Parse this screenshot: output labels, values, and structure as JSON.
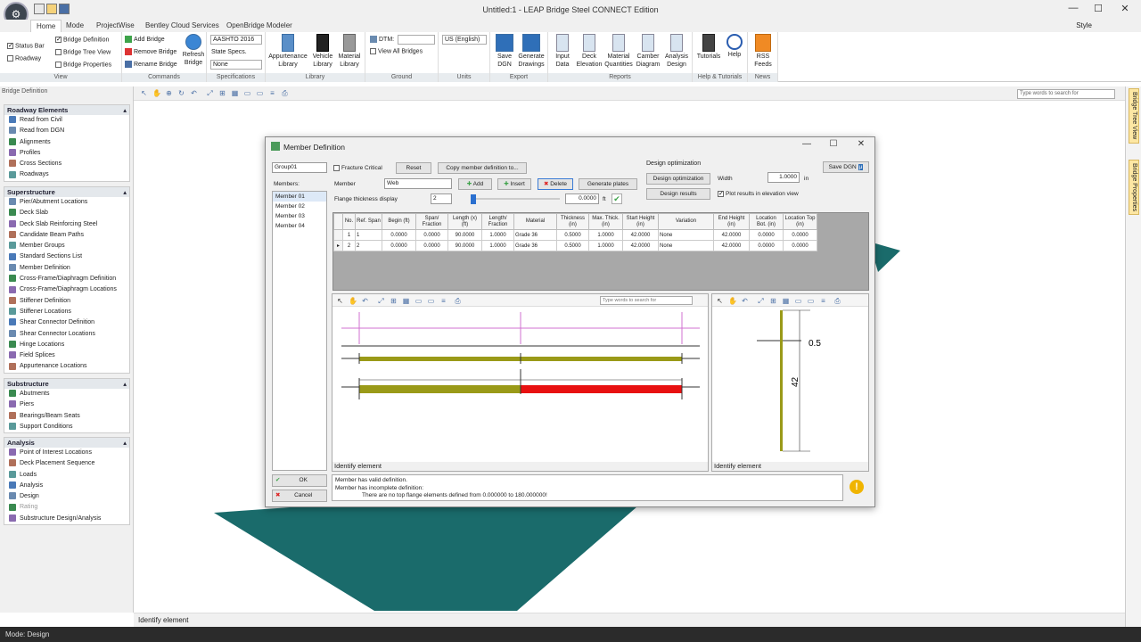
{
  "window": {
    "title": "Untitled:1 - LEAP Bridge Steel CONNECT Edition",
    "min": "—",
    "max": "☐",
    "close": "✕"
  },
  "tabs": [
    "Home",
    "Mode",
    "ProjectWise",
    "Bentley Cloud Services",
    "OpenBridge Modeler"
  ],
  "style_label": "Style",
  "ribbon": {
    "view": {
      "label": "View",
      "status_bar": "Status Bar",
      "roadway": "Roadway",
      "bridge_definition": "Bridge Definition",
      "bridge_tree_view": "Bridge Tree View",
      "bridge_properties": "Bridge Properties"
    },
    "commands": {
      "label": "Commands",
      "add_bridge": "Add Bridge",
      "remove_bridge": "Remove Bridge",
      "rename_bridge": "Rename Bridge",
      "refresh_bridge": "Refresh Bridge"
    },
    "specifications": {
      "label": "Specifications",
      "code": "AASHTO 2016",
      "state_specs": "State Specs.",
      "state_value": "None"
    },
    "library": {
      "label": "Library",
      "appurtenance": "Appurtenance Library",
      "vehicle": "Vehicle Library",
      "material": "Material Library"
    },
    "ground": {
      "label": "Ground",
      "dtm": "DTM:",
      "view_all": "View All Bridges"
    },
    "units": {
      "label": "Units",
      "value": "US (English)"
    },
    "export": {
      "label": "Export",
      "save_dgn": "Save DGN",
      "generate": "Generate Drawings"
    },
    "reports": {
      "label": "Reports",
      "items": [
        "Input Data",
        "Deck Elevation",
        "Material Quantities",
        "Camber Diagram",
        "Analysis Design"
      ]
    },
    "help": {
      "label": "Help & Tutorials",
      "tutorials": "Tutorials",
      "help": "Help"
    },
    "news": {
      "label": "News",
      "rss": "RSS Feeds"
    }
  },
  "main_search_placeholder": "Type words to search for",
  "left_panel": {
    "title": "Bridge Definition",
    "sections": [
      {
        "title": "Roadway Elements",
        "items": [
          "Read from Civil",
          "Read from DGN",
          "Alignments",
          "Profiles",
          "Cross Sections",
          "Roadways"
        ]
      },
      {
        "title": "Superstructure",
        "items": [
          "Pier/Abutment Locations",
          "Deck Slab",
          "Deck Slab Reinforcing Steel",
          "Candidate Beam Paths",
          "Member Groups",
          "Standard Sections List",
          "Member Definition",
          "Cross-Frame/Diaphragm Definition",
          "Cross-Frame/Diaphragm Locations",
          "Stiffener Definition",
          "Stiffener Locations",
          "Shear Connector Definition",
          "Shear Connector Locations",
          "Hinge Locations",
          "Field Splices",
          "Appurtenance Locations"
        ]
      },
      {
        "title": "Substructure",
        "items": [
          "Abutments",
          "Piers",
          "Bearings/Beam Seats",
          "Support Conditions"
        ]
      },
      {
        "title": "Analysis",
        "items": [
          "Point of Interest Locations",
          "Deck Placement Sequence",
          "Loads",
          "Analysis",
          "Design",
          "Rating",
          "Substructure Design/Analysis"
        ]
      }
    ]
  },
  "right_tabs": [
    "Bridge Tree View",
    "Bridge Properties"
  ],
  "main_status": "Identify element",
  "mode": "Mode: Design",
  "dialog": {
    "title": "Member Definition",
    "group": "Group01",
    "fracture_critical": "Fracture Critical",
    "reset": "Reset",
    "copy": "Copy member definition to...",
    "members_label": "Members:",
    "members": [
      "Member 01",
      "Member 02",
      "Member 03",
      "Member 04"
    ],
    "member_label": "Member",
    "member_value": "Web",
    "add": "Add",
    "insert": "Insert",
    "delete": "Delete",
    "generate_plates": "Generate plates",
    "flange_label": "Flange thickness display",
    "flange_value": "2",
    "slider_value": "0.0000",
    "slider_unit": "ft",
    "design_opt_title": "Design optimization",
    "design_opt_btn": "Design optimization",
    "width_label": "Width",
    "width_value": "1.0000",
    "width_unit": "in",
    "design_results": "Design results",
    "plot_results": "Plot results in elevation view",
    "save_dgn": "Save DGN",
    "columns": [
      "No.",
      "Ref. Span",
      "Begin (ft)",
      "Span/ Fraction",
      "Length (x) (ft)",
      "Length/ Fraction",
      "Material",
      "Thickness (in)",
      "Max. Thick. (in)",
      "Start Height (in)",
      "Variation",
      "End Height (in)",
      "Location Bot. (in)",
      "Location Top (in)"
    ],
    "rows": [
      [
        "1",
        "1",
        "0.0000",
        "0.0000",
        "90.0000",
        "1.0000",
        "Grade 36",
        "0.5000",
        "1.0000",
        "42.0000",
        "None",
        "42.0000",
        "0.0000",
        "0.0000"
      ],
      [
        "2",
        "2",
        "0.0000",
        "0.0000",
        "90.0000",
        "1.0000",
        "Grade 36",
        "0.5000",
        "1.0000",
        "42.0000",
        "None",
        "42.0000",
        "0.0000",
        "0.0000"
      ]
    ],
    "elev_search": "Type words to search for",
    "elev_status": "Identify element",
    "section_status": "Identify element",
    "dim_thickness": "0.5",
    "dim_height": "42",
    "ok": "OK",
    "cancel": "Cancel",
    "messages": [
      "Member has valid definition.",
      "Member has incomplete definition:",
      "There are no top flange elements defined from 0.000000 to 180.000000!"
    ]
  }
}
